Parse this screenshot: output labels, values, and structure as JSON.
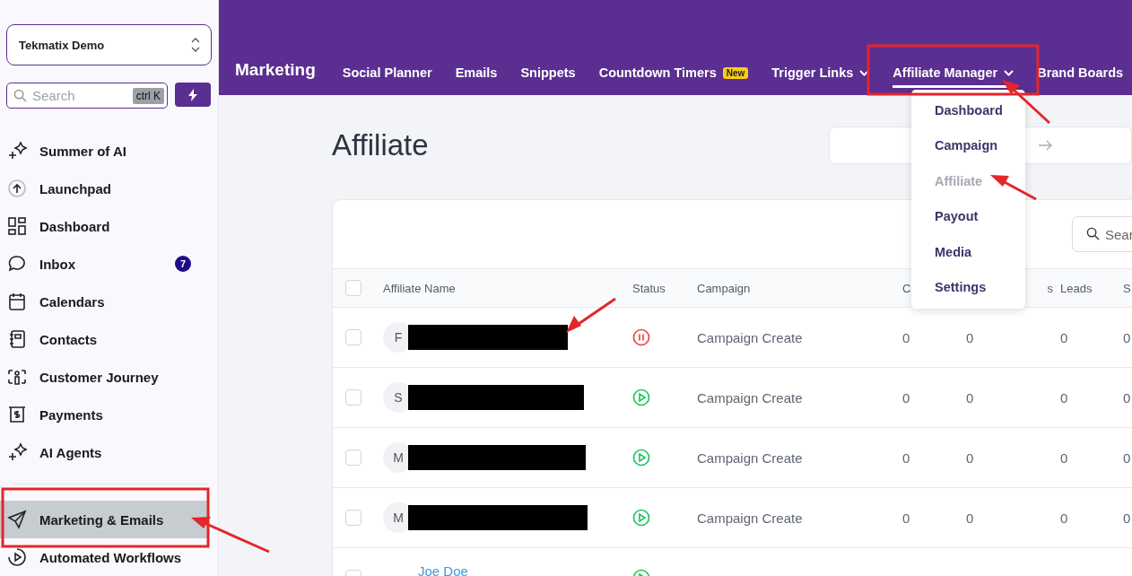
{
  "sidebar": {
    "account": "Tekmatix Demo",
    "search": {
      "placeholder": "Search",
      "shortcut": "ctrl K"
    },
    "items": [
      {
        "label": "Summer of AI",
        "selected": false
      },
      {
        "label": "Launchpad",
        "selected": false
      },
      {
        "label": "Dashboard",
        "selected": false
      },
      {
        "label": "Inbox",
        "selected": false,
        "badge": "7"
      },
      {
        "label": "Calendars",
        "selected": false
      },
      {
        "label": "Contacts",
        "selected": false
      },
      {
        "label": "Customer Journey",
        "selected": false
      },
      {
        "label": "Payments",
        "selected": false
      },
      {
        "label": "AI Agents",
        "selected": false
      }
    ],
    "bottom_items": [
      {
        "label": "Marketing & Emails",
        "selected": true
      },
      {
        "label": "Automated Workflows",
        "selected": false
      }
    ]
  },
  "topbar": {
    "title": "Marketing",
    "tabs": [
      {
        "label": "Social Planner",
        "selected": false,
        "dropdown": false
      },
      {
        "label": "Emails",
        "selected": false,
        "dropdown": false
      },
      {
        "label": "Snippets",
        "selected": false,
        "dropdown": false
      },
      {
        "label": "Countdown Timers",
        "selected": false,
        "dropdown": false,
        "badge": "New"
      },
      {
        "label": "Trigger Links",
        "selected": false,
        "dropdown": true
      },
      {
        "label": "Affiliate Manager",
        "selected": true,
        "dropdown": true
      },
      {
        "label": "Brand Boards",
        "selected": false,
        "dropdown": false
      }
    ]
  },
  "menu": {
    "items": [
      {
        "label": "Dashboard",
        "selected": false
      },
      {
        "label": "Campaign",
        "selected": false
      },
      {
        "label": "Affiliate",
        "selected": true
      },
      {
        "label": "Payout",
        "selected": false
      },
      {
        "label": "Media",
        "selected": false
      },
      {
        "label": "Settings",
        "selected": false
      }
    ]
  },
  "page": {
    "title": "Affiliate",
    "search": {
      "placeholder": "Sear"
    }
  },
  "table": {
    "all_checked": false,
    "columns": [
      "Affiliate Name",
      "Status",
      "Campaign",
      "C",
      "s",
      "Leads",
      "S"
    ],
    "rows": [
      {
        "checked": false,
        "initials": "F",
        "redacted": true,
        "paused": true,
        "campaign": "Campaign Create",
        "values": [
          "0",
          "0",
          "0",
          "0"
        ]
      },
      {
        "checked": false,
        "initials": "S",
        "redacted": true,
        "paused": false,
        "campaign": "Campaign Create",
        "values": [
          "0",
          "0",
          "0",
          "0"
        ]
      },
      {
        "checked": false,
        "initials": "M",
        "redacted": true,
        "paused": false,
        "campaign": "Campaign Create",
        "values": [
          "0",
          "0",
          "0",
          "0"
        ]
      },
      {
        "checked": false,
        "initials": "M",
        "redacted": true,
        "paused": false,
        "campaign": "Campaign Create",
        "values": [
          "0",
          "0",
          "0",
          "0"
        ]
      },
      {
        "checked": false,
        "name": "Joe Doe",
        "redacted": false,
        "paused": false
      }
    ]
  }
}
